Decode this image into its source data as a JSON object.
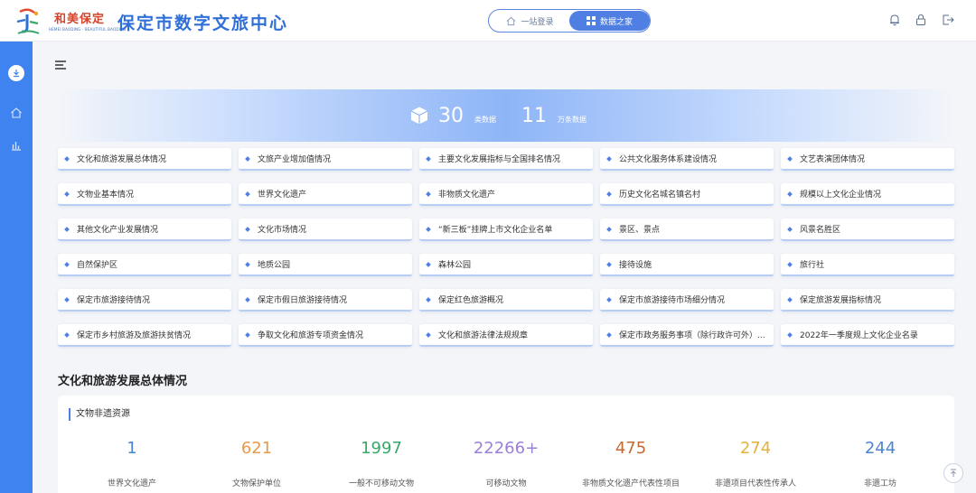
{
  "header": {
    "logo_cn": "和美保定",
    "logo_en": "HEMEI BAODING · BEAUTIFUL BAODING",
    "title": "保定市数字文旅中心",
    "switch_left": "一站登录",
    "switch_right": "数据之家"
  },
  "banner": {
    "count1": "30",
    "unit1": "类数据",
    "count2": "11",
    "unit2": "万条数据"
  },
  "categories": [
    "文化和旅游发展总体情况",
    "文旅产业增加值情况",
    "主要文化发展指标与全国排名情况",
    "公共文化服务体系建设情况",
    "文艺表演团体情况",
    "文物业基本情况",
    "世界文化遗产",
    "非物质文化遗产",
    "历史文化名城名镇名村",
    "规模以上文化企业情况",
    "其他文化产业发展情况",
    "文化市场情况",
    "“新三板”挂牌上市文化企业名单",
    "景区、景点",
    "风景名胜区",
    "自然保护区",
    "地质公园",
    "森林公园",
    "接待设施",
    "旅行社",
    "保定市旅游接待情况",
    "保定市假日旅游接待情况",
    "保定红色旅游概况",
    "保定市旅游接待市场细分情况",
    "保定旅游发展指标情况",
    "保定市乡村旅游及旅游扶贫情况",
    "争取文化和旅游专项资金情况",
    "文化和旅游法律法规规章",
    "保定市政务服务事项（除行政许可外）...",
    "2022年一季度规上文化企业名录"
  ],
  "section": {
    "title": "文化和旅游发展总体情况",
    "subtitle": "文物非遗资源"
  },
  "metrics": [
    {
      "value": "1",
      "label": "世界文化遗产",
      "color": "#4a86d6"
    },
    {
      "value": "621",
      "label": "文物保护单位",
      "color": "#e69a4a"
    },
    {
      "value": "1997",
      "label": "一般不可移动文物",
      "color": "#37a86a"
    },
    {
      "value": "22266+",
      "label": "可移动文物",
      "color": "#9b7fd8"
    },
    {
      "value": "475",
      "label": "非物质文化遗产代表性项目",
      "color": "#c46a34"
    },
    {
      "value": "274",
      "label": "非遗项目代表性传承人",
      "color": "#e3b23c"
    },
    {
      "value": "244",
      "label": "非遗工坊",
      "color": "#4a86d6"
    }
  ]
}
